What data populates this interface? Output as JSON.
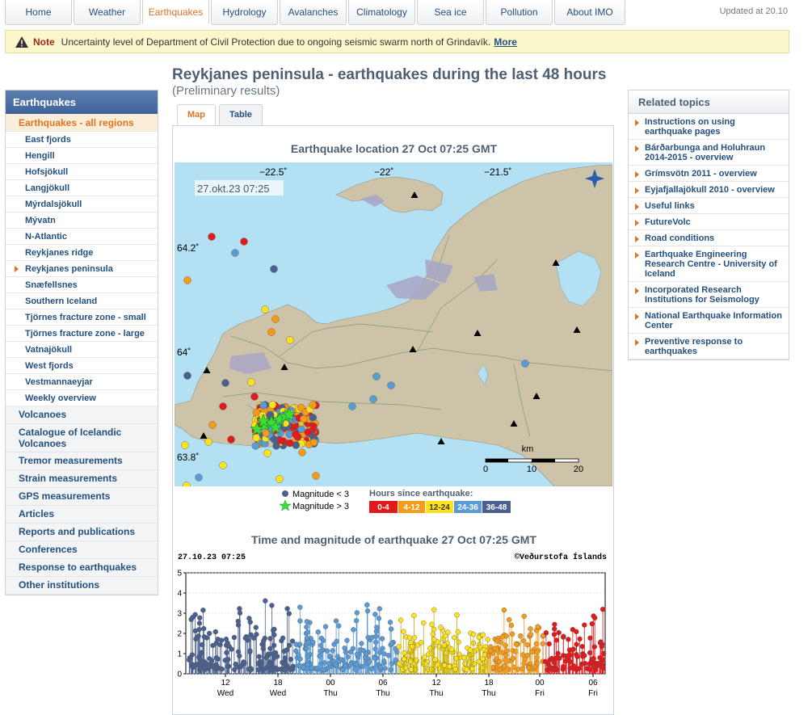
{
  "nav": {
    "tabs": [
      {
        "label": "Home",
        "width": 83
      },
      {
        "label": "Weather",
        "width": 83
      },
      {
        "label": "Earthquakes",
        "width": 83,
        "active": true
      },
      {
        "label": "Hydrology",
        "width": 83
      },
      {
        "label": "Avalanches",
        "width": 83
      },
      {
        "label": "Climatology",
        "width": 83
      },
      {
        "label": "Sea ice",
        "width": 83
      },
      {
        "label": "Pollution",
        "width": 83
      },
      {
        "label": "About IMO",
        "width": 88
      }
    ],
    "updated": "Updated at 20.10"
  },
  "note": {
    "label": "Note",
    "text": "Uncertainty level of Department of Civil Protection due to ongoing seismic swarm north of Grindavík.",
    "more": "More"
  },
  "sidebar": {
    "heading": "Earthquakes",
    "current": "Earthquakes - all regions",
    "regions": [
      "East fjords",
      "Hengill",
      "Hofsjökull",
      "Langjökull",
      "Mýrdalsjökull",
      "Mývatn",
      "N-Atlantic",
      "Reykjanes ridge",
      "Reykjanes peninsula",
      "Snæfellsnes",
      "Southern Iceland",
      "Tjörnes fracture zone - small",
      "Tjörnes fracture zone - large",
      "Vatnajökull",
      "West fjords",
      "Vestmannaeyjar",
      "Weekly overview"
    ],
    "selected_region": "Reykjanes peninsula",
    "sections": [
      "Volcanoes",
      "Catalogue of Icelandic Volcanoes",
      "Tremor measurements",
      "Strain measurements",
      "GPS measurements",
      "Articles",
      "Reports and publications",
      "Conferences",
      "Response to earthquakes",
      "Other institutions"
    ]
  },
  "main": {
    "title": "Reykjanes peninsula - earthquakes during the last 48 hours",
    "subtitle": "(Preliminary results)",
    "tabs": [
      "Map",
      "Table"
    ],
    "active_tab": "Map",
    "map": {
      "title": "Earthquake location   27 Oct 07:25 GMT",
      "timestamp": "27.okt.23  07:25",
      "lon_labels": [
        "−22.5˚",
        "−22˚",
        "−21.5˚"
      ],
      "lat_labels": [
        "64.2˚",
        "64˚",
        "63.8˚"
      ],
      "scale_unit": "km",
      "scale_labels": [
        "0",
        "10",
        "20"
      ]
    },
    "legend": {
      "small": "Magnitude < 3",
      "large": "Magnitude > 3",
      "hours_title": "Hours since earthquake:",
      "bins": [
        {
          "label": "0-4",
          "color": "#e31a1c"
        },
        {
          "label": "4-12",
          "color": "#f59b1a"
        },
        {
          "label": "12-24",
          "color": "#ffe21c"
        },
        {
          "label": "24-36",
          "color": "#5b9bd5"
        },
        {
          "label": "36-48",
          "color": "#4a6190"
        }
      ]
    },
    "plot": {
      "title": "Time and magnitude of earthquake   27 Oct 07:25 GMT",
      "timestamp": "27.10.23 07:25",
      "credit": "©Veðurstofa Íslands",
      "y_ticks": [
        "5",
        "4",
        "3",
        "2",
        "1",
        "0"
      ],
      "x_ticks": [
        {
          "h": "12",
          "d": "Wed"
        },
        {
          "h": "18",
          "d": "Wed"
        },
        {
          "h": "00",
          "d": "Thu"
        },
        {
          "h": "06",
          "d": "Thu"
        },
        {
          "h": "12",
          "d": "Thu"
        },
        {
          "h": "18",
          "d": "Thu"
        },
        {
          "h": "00",
          "d": "Fri"
        },
        {
          "h": "06",
          "d": "Fri"
        }
      ]
    }
  },
  "related": {
    "heading": "Related topics",
    "items": [
      "Instructions on using earthquake pages",
      "Bárðarbunga and Holuhraun 2014-2015 - overview",
      "Grímsvötn 2011 - overview",
      "Eyjafjallajökull 2010 - overview",
      "Useful links",
      "FutureVolc",
      "Road conditions",
      "Earthquake Engineering Research Centre - University of Iceland",
      "Incorporated Research Institutions for Seismology",
      "National Earthquake Information Center",
      "Preventive response to earthquakes"
    ]
  }
}
